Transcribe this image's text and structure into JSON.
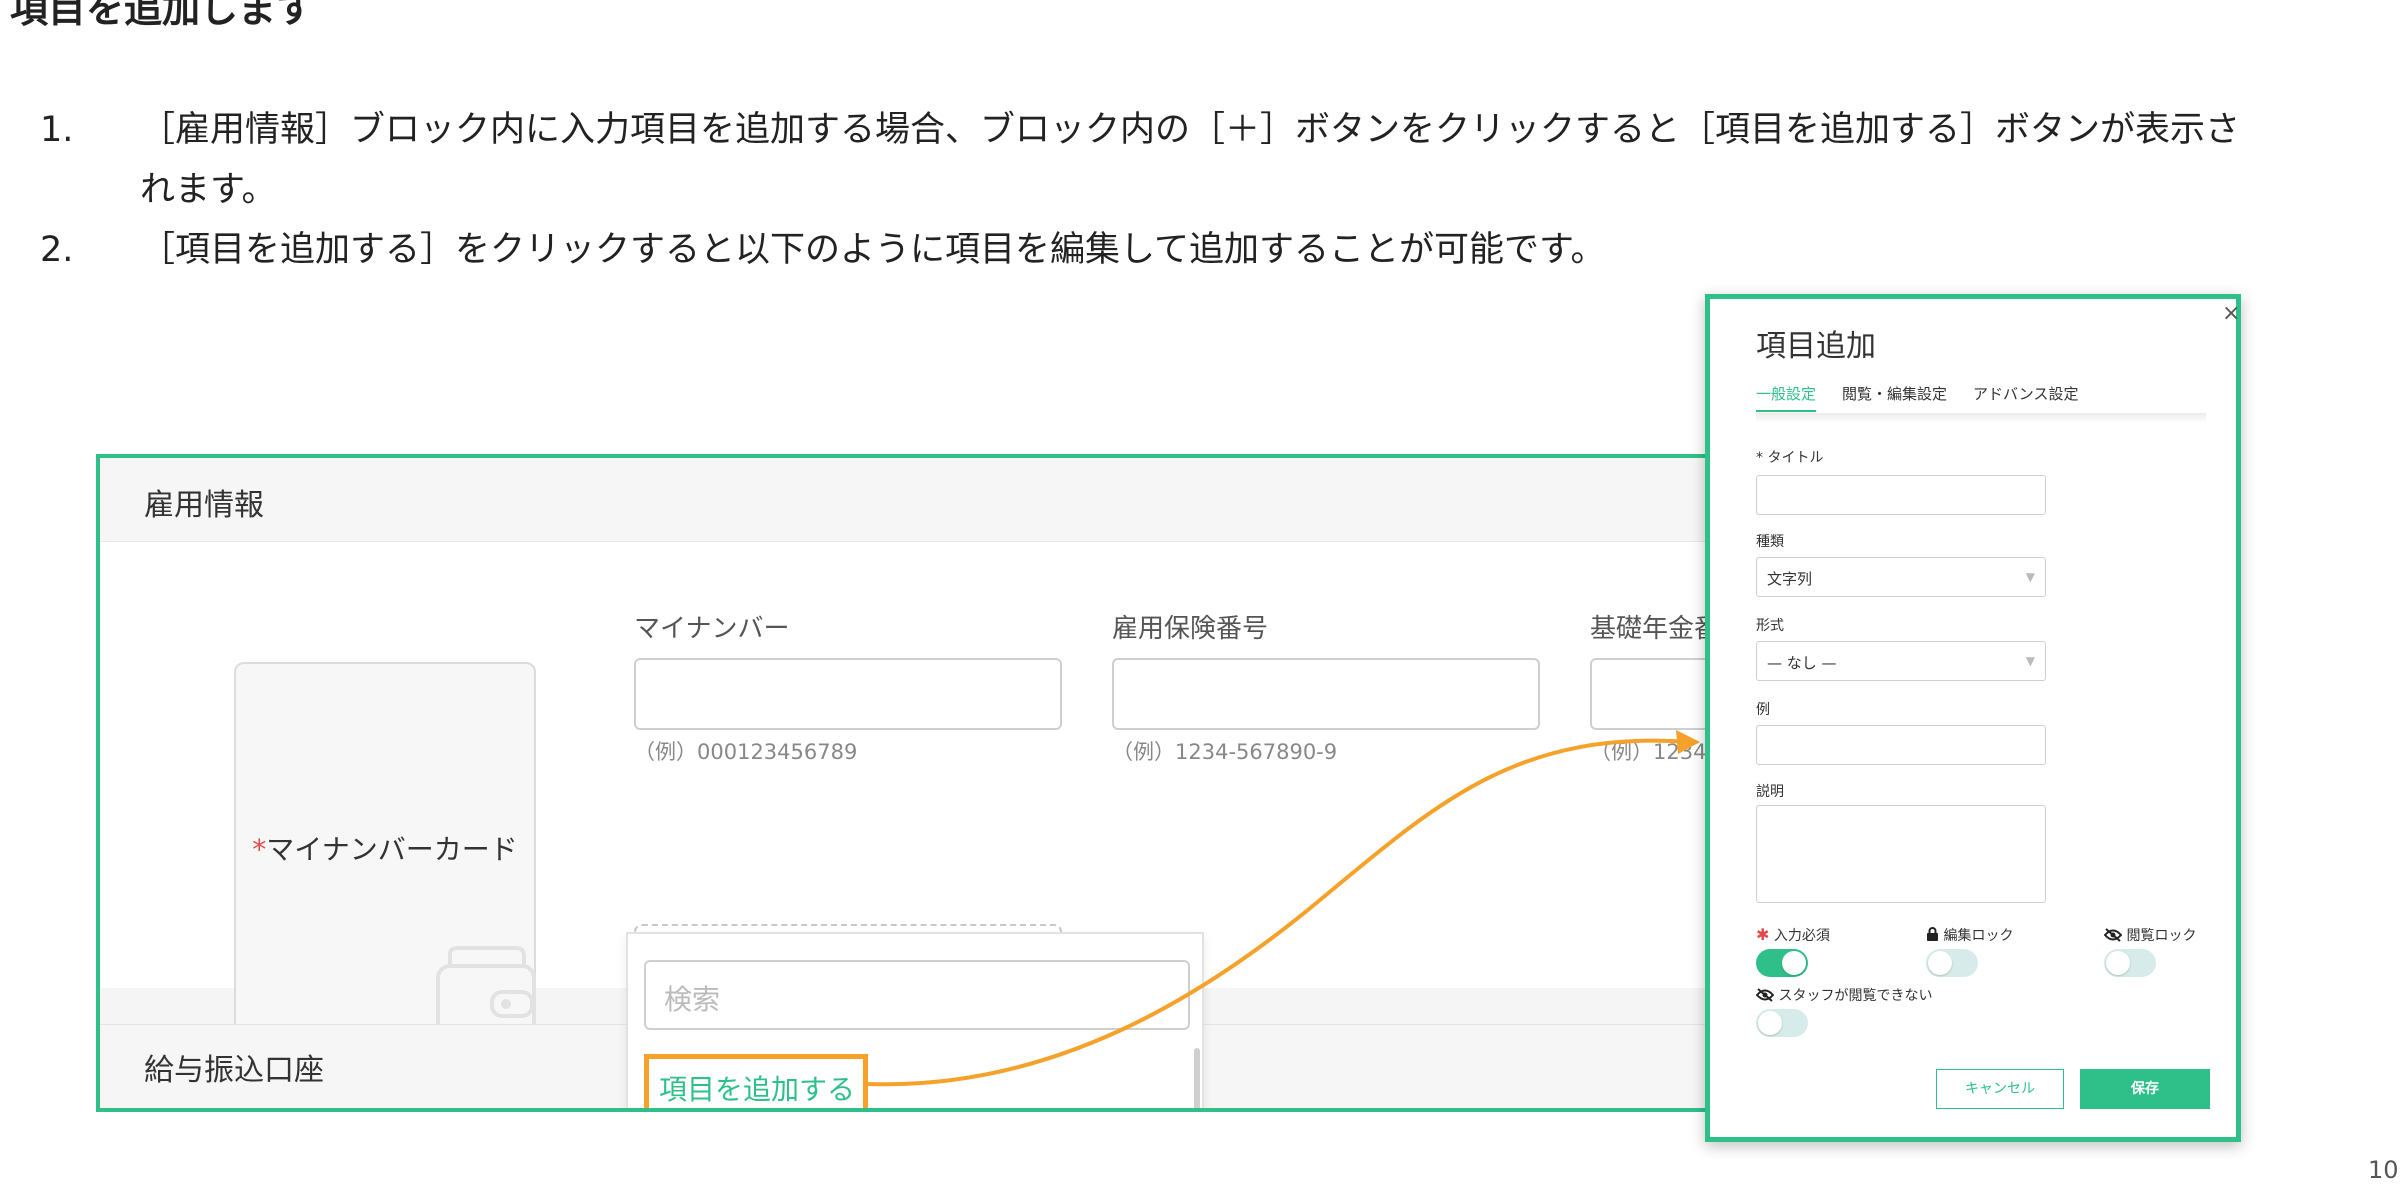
{
  "heading": "項目を追加します",
  "steps": [
    {
      "num": "1.",
      "text": "［雇用情報］ブロック内に入力項目を追加する場合、ブロック内の［＋］ボタンをクリックすると［項目を追加する］ボタンが表示されます。"
    },
    {
      "num": "2.",
      "text": "［項目を追加する］をクリックすると以下のように項目を編集して追加することが可能です。"
    }
  ],
  "employment": {
    "section_title": "雇用情報",
    "card_label_star": "*",
    "card_label": "マイナンバーカード",
    "fields": [
      {
        "label": "マイナンバー",
        "hint": "（例）000123456789"
      },
      {
        "label": "雇用保険番号",
        "hint": "（例）1234-567890-9"
      },
      {
        "label": "基礎年金番",
        "hint": "（例）1234"
      }
    ],
    "plus_label": "+",
    "search_placeholder": "検索",
    "add_item_label": "項目を追加する",
    "section2_title": "給与振込口座"
  },
  "modal": {
    "close": "×",
    "title": "項目追加",
    "tabs": [
      "一般設定",
      "閲覧・編集設定",
      "アドバンス設定"
    ],
    "title_label": "* タイトル",
    "type_label": "種類",
    "type_value": "文字列",
    "format_label": "形式",
    "format_value": "— なし —",
    "example_label": "例",
    "description_label": "説明",
    "required_label": "入力必須",
    "required_star": "✱",
    "edit_lock_label": "編集ロック",
    "view_lock_label": "閲覧ロック",
    "staff_hidden_label": "スタッフが閲覧できない",
    "required_on": true,
    "cancel": "キャンセル",
    "save": "保存"
  },
  "colors": {
    "accent": "#2fc08a",
    "highlight": "#f5a12a"
  },
  "page_number": "10"
}
